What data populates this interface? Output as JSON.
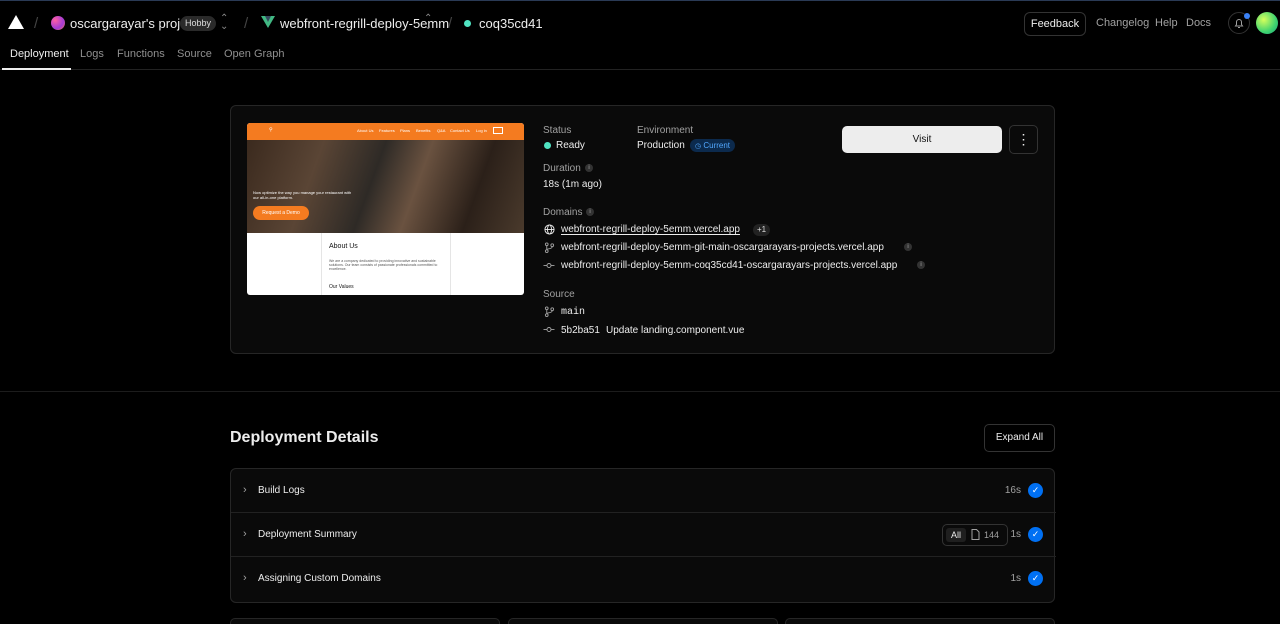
{
  "header": {
    "team_name": "oscargarayar's projects",
    "team_plan": "Hobby",
    "project_name": "webfront-regrill-deploy-5emm",
    "deployment_id": "coq35cd41",
    "feedback_label": "Feedback",
    "links": [
      "Changelog",
      "Help",
      "Docs"
    ]
  },
  "tabs": [
    "Deployment",
    "Logs",
    "Functions",
    "Source",
    "Open Graph"
  ],
  "preview": {
    "nav_items": [
      "About Us",
      "Features",
      "Plans",
      "Benefits",
      "Q&A",
      "Contact Us",
      "Log in"
    ],
    "hero_text": "Now optimize the way you manage your restaurant with our all-in-one platform.",
    "hero_button": "Request a Demo",
    "about_title": "About Us",
    "about_text": "We are a company dedicated to providing innovative and sustainable solutions. Our team consists of passionate professionals committed to excellence.",
    "values_title": "Our Values"
  },
  "deployment": {
    "status_label": "Status",
    "status_value": "Ready",
    "environment_label": "Environment",
    "environment_value": "Production",
    "current_badge": "Current",
    "duration_label": "Duration",
    "duration_value": "18s (1m ago)",
    "domains_label": "Domains",
    "domains": [
      "webfront-regrill-deploy-5emm.vercel.app",
      "webfront-regrill-deploy-5emm-git-main-oscargarayars-projects.vercel.app",
      "webfront-regrill-deploy-5emm-coq35cd41-oscargarayars-projects.vercel.app"
    ],
    "domains_extra": "+1",
    "source_label": "Source",
    "branch": "main",
    "commit_hash": "5b2ba51",
    "commit_message": "Update landing.component.vue",
    "visit_label": "Visit"
  },
  "details": {
    "title": "Deployment Details",
    "expand_label": "Expand All",
    "rows": [
      {
        "label": "Build Logs",
        "time": "16s"
      },
      {
        "label": "Deployment Summary",
        "time": "1s",
        "filter": "All",
        "file_count": "144"
      },
      {
        "label": "Assigning Custom Domains",
        "time": "1s"
      }
    ]
  },
  "colors": {
    "accent_blue": "#0070f3",
    "ready_green": "#50e3c2",
    "brand_orange": "#f47b20"
  }
}
